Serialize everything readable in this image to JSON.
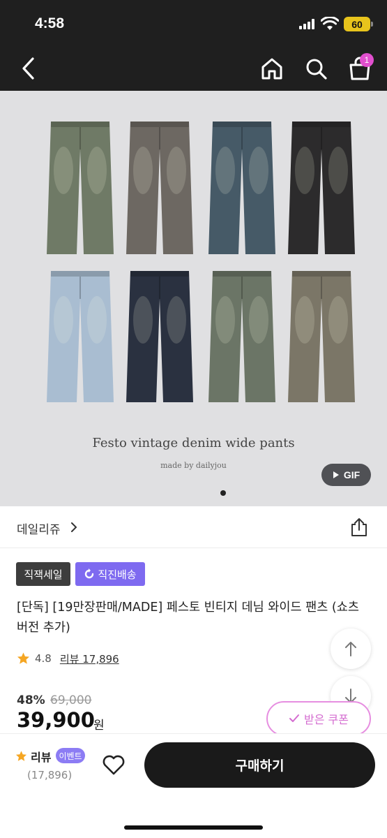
{
  "status_bar": {
    "time": "4:58",
    "battery": "60"
  },
  "header": {
    "cart_count": "1"
  },
  "hero": {
    "title": "Festo vintage denim wide pants",
    "subtitle": "made by dailyjou",
    "gif_label": "GIF",
    "jeans_colors": [
      "#6f7a66",
      "#6d6862",
      "#465a67",
      "#2c2b2c",
      "#a9bdd1",
      "#2a3140",
      "#6b7566",
      "#7b7667"
    ],
    "page_indicator": {
      "current": 1,
      "total": 1
    }
  },
  "store": {
    "name": "데일리쥬"
  },
  "tags": {
    "sale": "직잭세일",
    "shipping": "직진배송"
  },
  "product": {
    "title": "[단독] [19만장판매/MADE] 페스토 빈티지 데님 와이드 팬츠 (쇼츠 버전 추가)",
    "rating": "4.8",
    "reviews": "리뷰 17,896",
    "discount": "48%",
    "original_price": "69,000",
    "price": "39,900",
    "currency": "원",
    "coupon_label": "받은 쿠폰"
  },
  "bottom_bar": {
    "review_label": "리뷰",
    "event_badge": "이벤트",
    "review_count": "(17,896)",
    "buy_label": "구매하기"
  },
  "colors": {
    "accent_purple": "#7e6af0",
    "coupon_pink": "#e68ee0",
    "star": "#f5a623",
    "cart_badge": "#e14fce"
  }
}
